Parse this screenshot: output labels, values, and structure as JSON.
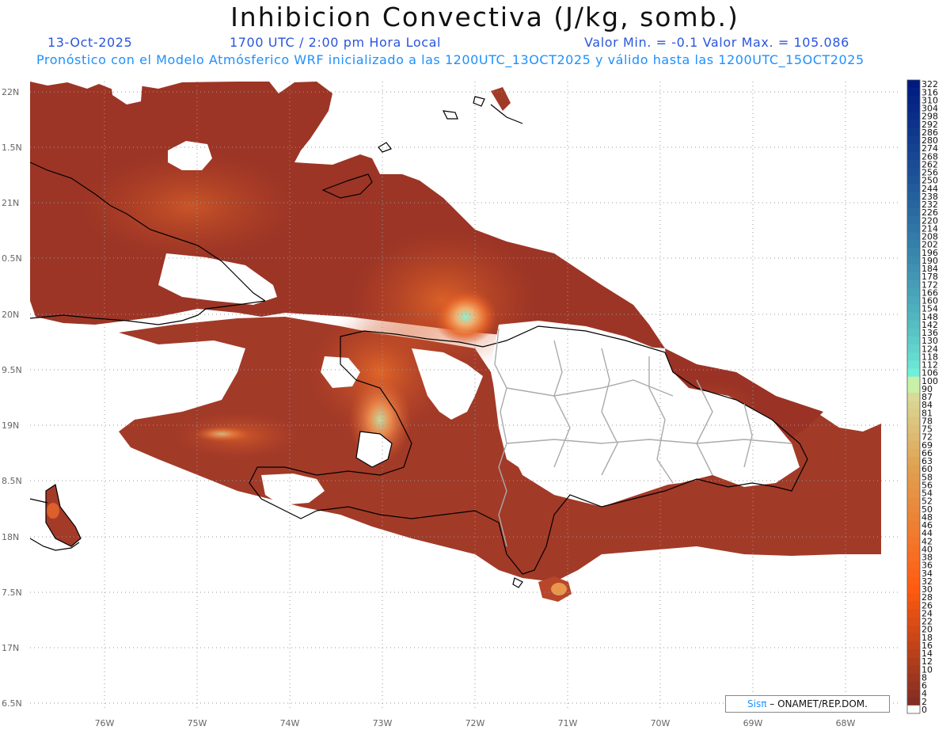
{
  "title": "Inhibicion Convectiva (J/kg, somb.)",
  "date": "13-Oct-2025",
  "time": "1700 UTC / 2:00 pm Hora Local",
  "minmax": "Valor Min. = -0.1  Valor Max. = 105.086",
  "description": "Pronóstico con el Modelo Atmósferico WRF inicializado a las 1200UTC_13OCT2025 y válido hasta las  1200UTC_15OCT2025",
  "lat_labels": [
    "22N",
    "1.5N",
    "21N",
    "0.5N",
    "20N",
    "9.5N",
    "19N",
    "8.5N",
    "18N",
    "7.5N",
    "17N",
    "6.5N"
  ],
  "lon_labels": [
    "76W",
    "75W",
    "74W",
    "73W",
    "72W",
    "71W",
    "70W",
    "69W",
    "68W"
  ],
  "colorbar": {
    "labels": [
      "322",
      "316",
      "310",
      "304",
      "298",
      "292",
      "286",
      "280",
      "274",
      "268",
      "262",
      "256",
      "250",
      "244",
      "238",
      "232",
      "226",
      "220",
      "214",
      "208",
      "202",
      "196",
      "190",
      "184",
      "178",
      "172",
      "166",
      "160",
      "154",
      "148",
      "142",
      "136",
      "130",
      "124",
      "118",
      "112",
      "106",
      "100",
      "90",
      "87",
      "84",
      "81",
      "78",
      "75",
      "72",
      "69",
      "66",
      "63",
      "60",
      "58",
      "56",
      "54",
      "52",
      "50",
      "48",
      "46",
      "44",
      "42",
      "40",
      "38",
      "36",
      "34",
      "32",
      "30",
      "28",
      "26",
      "24",
      "22",
      "20",
      "18",
      "16",
      "14",
      "12",
      "10",
      "8",
      "6",
      "4",
      "2",
      "0"
    ]
  },
  "credit": {
    "brand": "Sisπ",
    "text": " – ONAMET/REP.DOM."
  },
  "colors": {
    "field_low": "#8b2e22",
    "field_mid": "#e0602a",
    "field_high": "#90f0d0",
    "coastline": "#000000",
    "borders": "#aaaaaa"
  }
}
